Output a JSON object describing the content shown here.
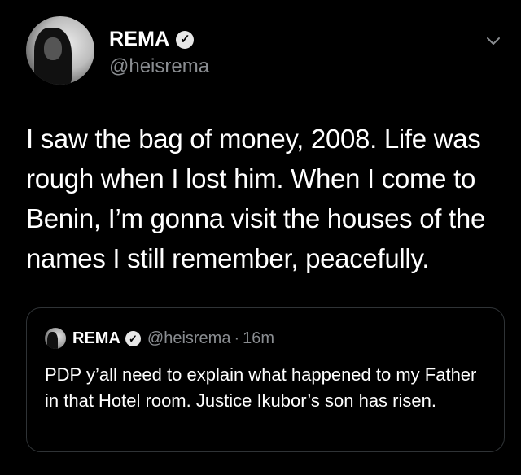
{
  "tweet": {
    "author_name": "REMA",
    "handle": "@heisrema",
    "text": "I saw the bag of money, 2008. Life was rough when I lost him. When I come to Benin, I’m gonna visit the houses of the names I still remember, peacefully.",
    "verified_icon": "verified-check-icon",
    "menu_icon": "chevron-down-icon"
  },
  "quoted_tweet": {
    "author_name": "REMA",
    "handle": "@heisrema",
    "separator": "·",
    "time": "16m",
    "text": "PDP y’all need to explain what happened to my Father in that Hotel room. Justice Ikubor’s son has risen."
  },
  "colors": {
    "background": "#000000",
    "text": "#ffffff",
    "secondary_text": "#8a8d91",
    "border": "#2f3336"
  }
}
